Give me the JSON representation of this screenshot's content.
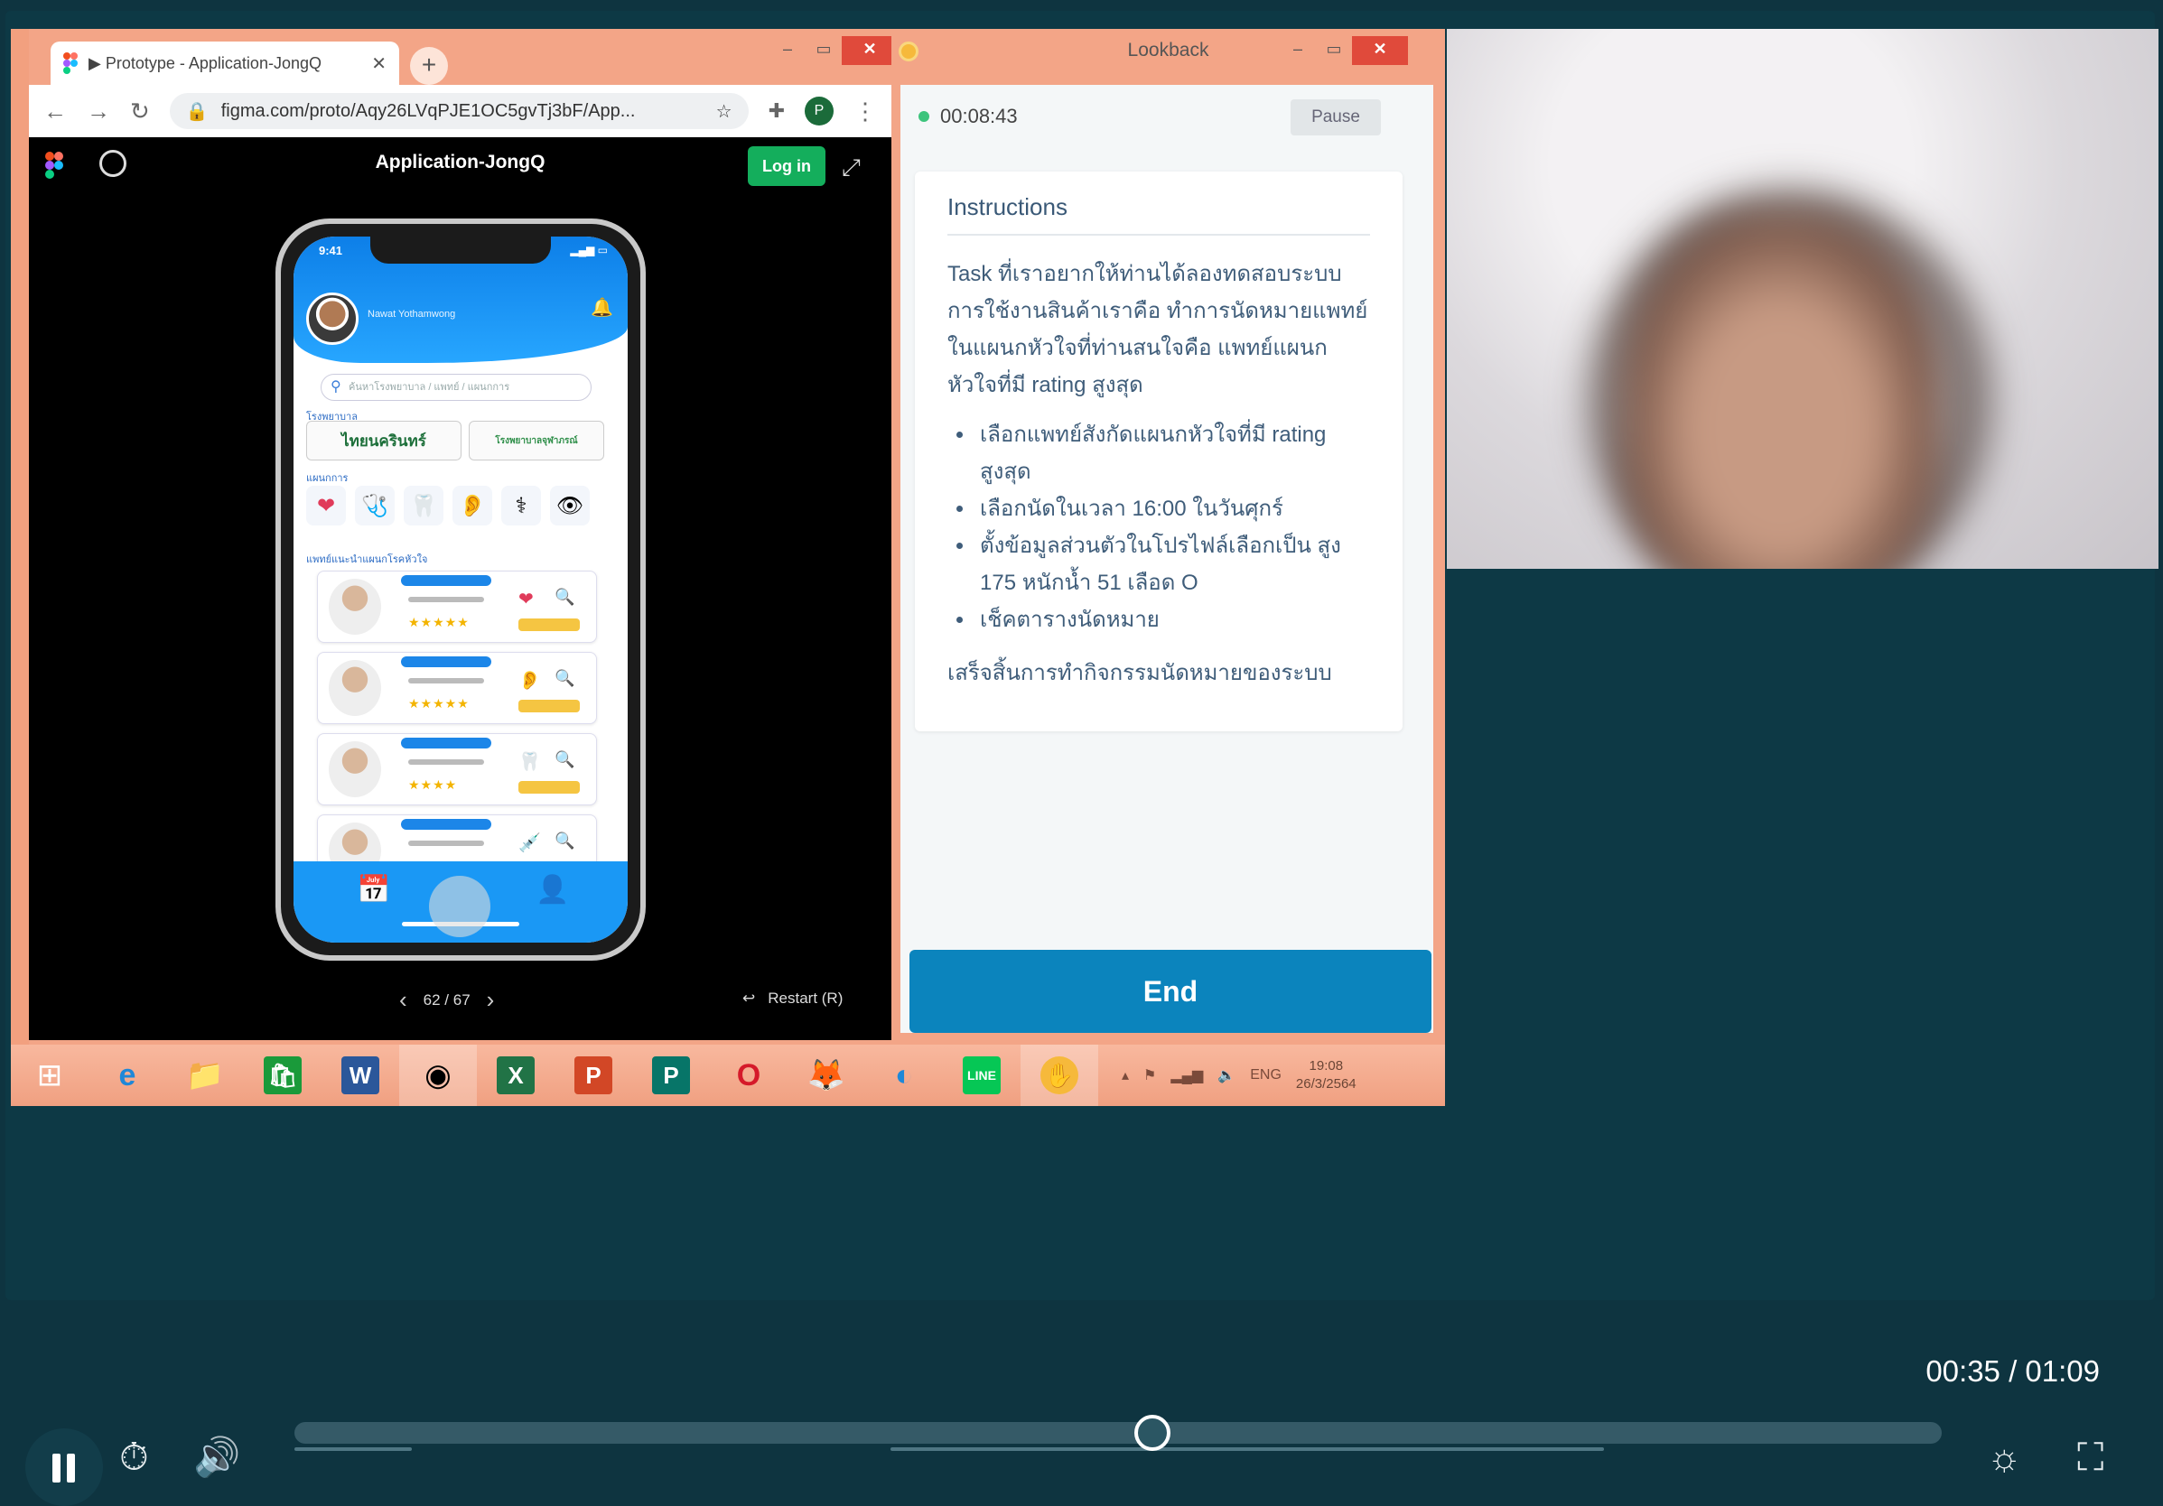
{
  "browser": {
    "tab_title": "▶ Prototype - Application-JongQ",
    "url": "figma.com/proto/Aqy26LVqPJE1OC5gvTj3bF/App...",
    "profile_initial": "P"
  },
  "figma": {
    "title": "Application-JongQ",
    "login_label": "Log in",
    "page_counter": "62 / 67",
    "restart_label": "Restart (R)"
  },
  "phone": {
    "status_time": "9:41",
    "user_name": "Nawat Yothamwong",
    "search_placeholder": "ค้นหาโรงพยาบาล / แพทย์ / แผนกการ",
    "section_hospitals": "โรงพยาบาล",
    "hospital_1": "ไทยนครินทร์",
    "hospital_2": "โรงพยาบาลจุฬาภรณ์",
    "section_departments": "แผนกการ",
    "section_doctors": "แพทย์แนะนำแผนกโรคหัวใจ",
    "department_icons": [
      "❤",
      "🩺",
      "🦷",
      "👂",
      "⚕",
      "👁"
    ]
  },
  "lookback": {
    "window_title": "Lookback",
    "elapsed": "00:08:43",
    "pause_label": "Pause",
    "instructions_title": "Instructions",
    "intro": "Task ที่เราอยากให้ท่านได้ลองทดสอบระบบการใช้งานสินค้าเราคือ ทำการนัดหมายแพทย์ในแผนกหัวใจที่ท่านสนใจคือ แพทย์แผนกหัวใจที่มี rating สูงสุด",
    "steps": [
      "เลือกแพทย์สังกัดแผนกหัวใจที่มี rating สูงสุด",
      "เลือกนัดในเวลา 16:00 ในวันศุกร์",
      "ตั้งข้อมูลส่วนตัวในโปรไฟล์เลือกเป็น สูง 175 หนักน้ำ 51 เลือด O",
      "เช็คตารางนัดหมาย"
    ],
    "outro": "เสร็จสิ้นการทำกิจกรรมนัดหมายของระบบ",
    "end_label": "End"
  },
  "taskbar": {
    "lang": "ENG",
    "clock_time": "19:08",
    "clock_date": "26/3/2564"
  },
  "player": {
    "time": "00:35 / 01:09",
    "progress_fraction": 0.521,
    "buffer_start_fraction": 0.362,
    "buffer_end_fraction": 0.795
  }
}
